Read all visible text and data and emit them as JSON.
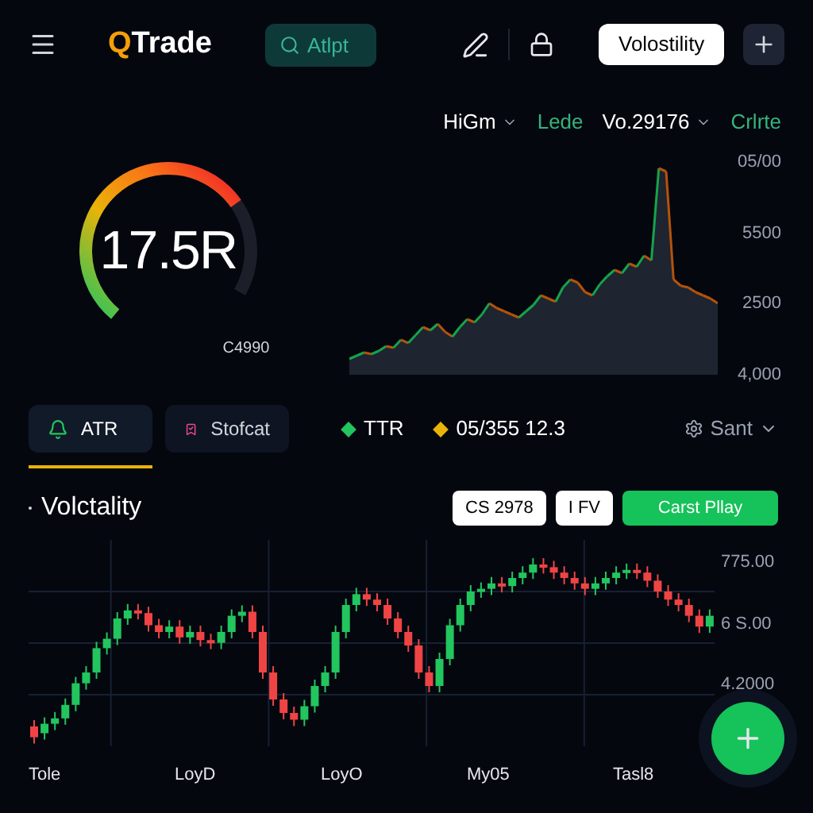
{
  "header": {
    "logo_accent": "Q",
    "logo_rest": "Trade",
    "search": {
      "placeholder": "Atlpt"
    },
    "action_button": "Volostility"
  },
  "gauge": {
    "value": "17.5R",
    "caption": "C4990"
  },
  "overview": {
    "filters": [
      {
        "label": "HiGm",
        "kind": "dropdown"
      },
      {
        "label": "Lede",
        "kind": "link"
      },
      {
        "label": "Vo.29176",
        "kind": "dropdown"
      },
      {
        "label": "Crlrte",
        "kind": "link"
      }
    ],
    "y_labels": [
      "05/00",
      "5500",
      "2500",
      "4,000"
    ]
  },
  "tabs": [
    {
      "label": "ATR",
      "selected": true
    },
    {
      "label": "Stofcat",
      "selected": false
    }
  ],
  "legend": [
    {
      "label": "TTR",
      "color": "#22c55e"
    },
    {
      "label": "05/355 12.3",
      "color": "#eab308"
    }
  ],
  "settings_dropdown": "Sant",
  "volatility": {
    "title": "Volctality",
    "buttons": [
      {
        "label": "CS 2978",
        "kind": "outline"
      },
      {
        "label": "I FV",
        "kind": "outline"
      },
      {
        "label": "Carst Pllay",
        "kind": "primary"
      }
    ],
    "y_labels": [
      "775.00",
      "6 S.00",
      "4.2000"
    ],
    "x_labels": [
      "Tole",
      "LoyD",
      "LoyO",
      "My05",
      "Tasl8"
    ]
  }
}
